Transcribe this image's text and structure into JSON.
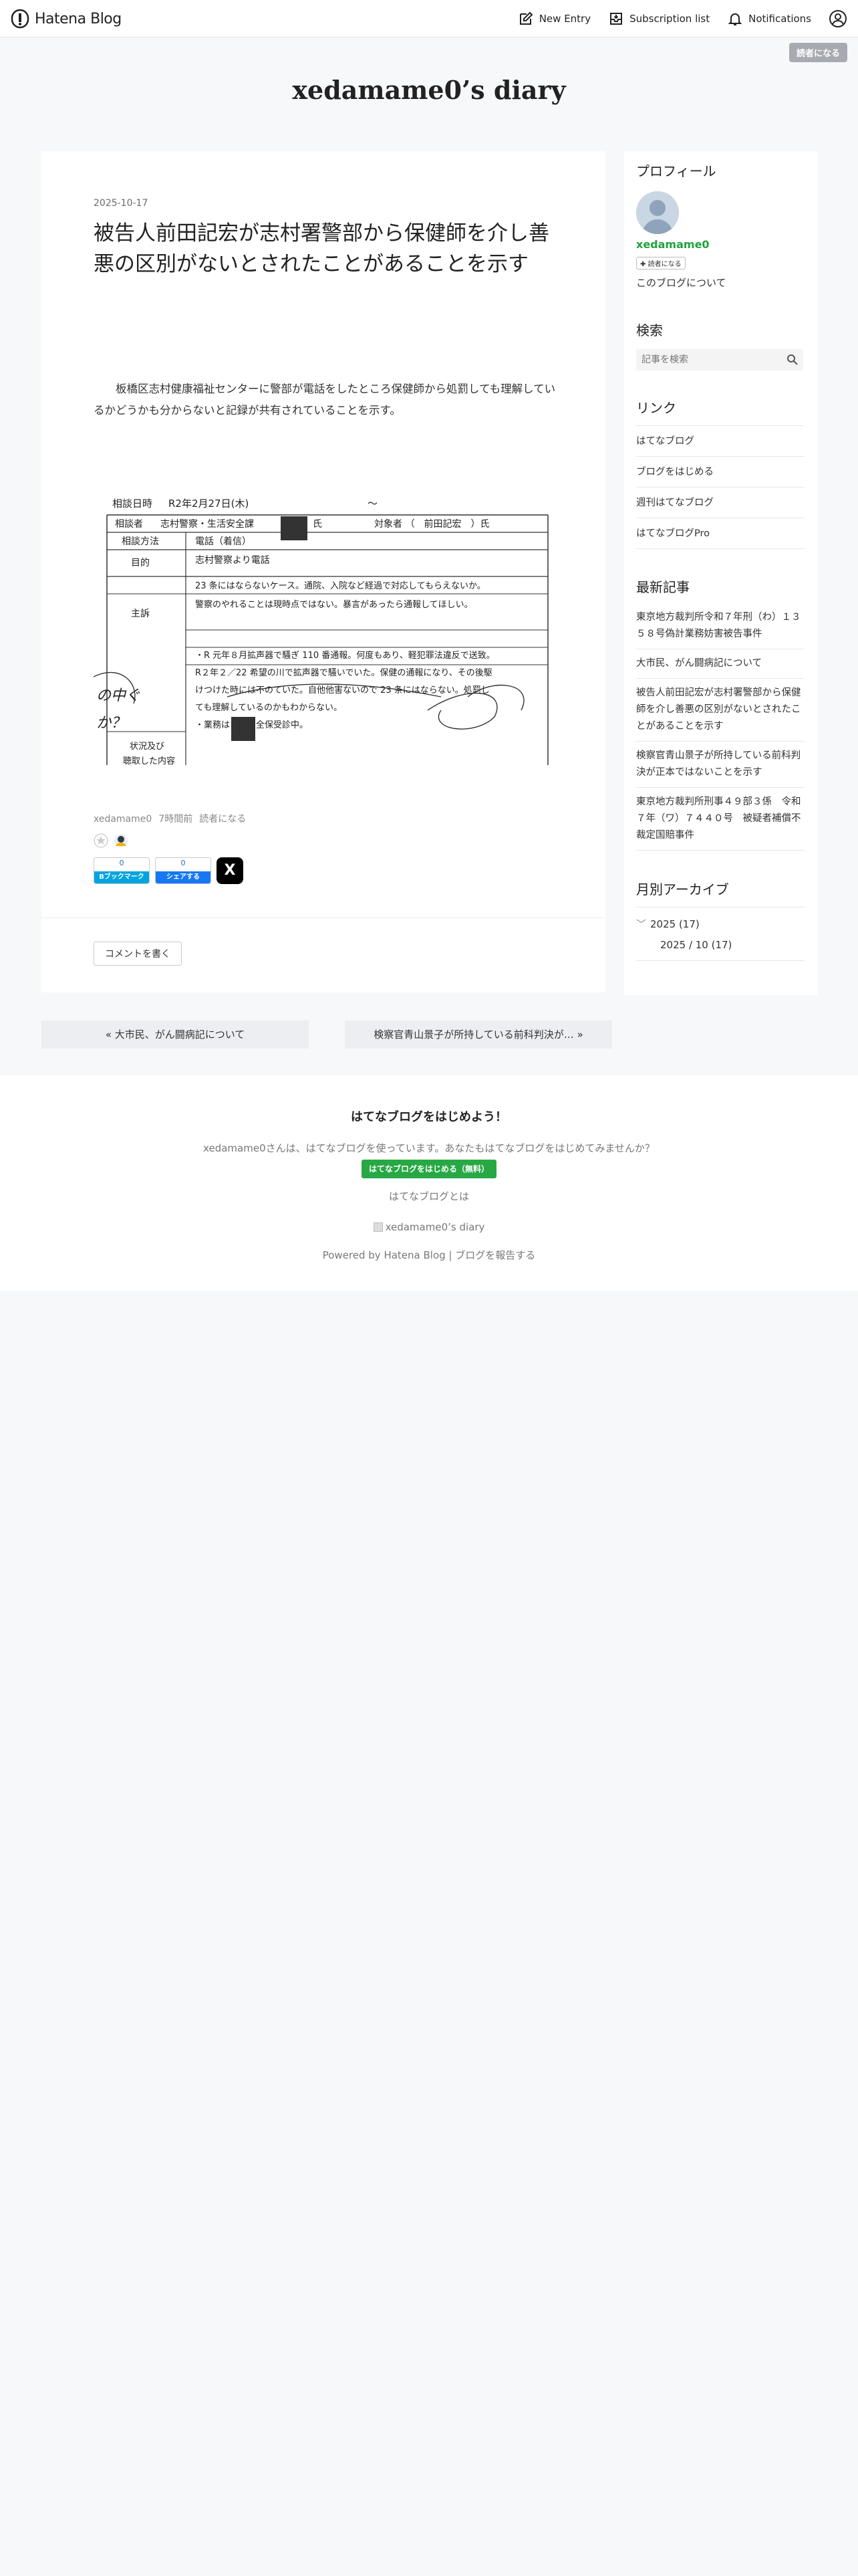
{
  "header": {
    "brand": "Hatena Blog",
    "nav": [
      {
        "label": "New Entry",
        "icon": "edit-icon"
      },
      {
        "label": "Subscription list",
        "icon": "inbox-icon"
      },
      {
        "label": "Notifications",
        "icon": "bell-icon"
      }
    ],
    "reader_badge": "読者になる"
  },
  "blog": {
    "title": "xedamame0’s diary"
  },
  "entry": {
    "date": "2025-10-17",
    "title": "被告人前田記宏が志村署警部から保健師を介し善悪の区別がないとされたことがあることを示す",
    "body": "板橋区志村健康福祉センターに警部が電話をしたところ保健師から処罰しても理解しているかどうかも分からないと記録が共有されていることを示す。",
    "document": {
      "line1_a": "相談日時",
      "line1_b": "R2年2月27日(木)",
      "line1_c": "～",
      "row2_a": "相談者",
      "row2_b": "志村警察・生活安全課",
      "row2_c": "氏",
      "row2_d": "対象者 （　前田記宏　）氏",
      "row3_a": "相談方法",
      "row3_b": "電話（着信）",
      "row4_a": "目的",
      "row4_b": "志村警察より電話",
      "row5_a": "主訴",
      "row5_line1": "23 条にはならないケース。通院、入院など経過で対応してもらえないか。",
      "row5_line2": "警察のやれることは現時点ではない。暴言があったら通報してほしい。",
      "row6_line1": "・R 元年８月拡声器で騒ぎ 110 番通報。何度もあり、軽犯罪法違反で送致。",
      "row6_line2": "R２年２／22 希望の川で拡声器で騒いでいた。保健の通報になり、その後駆",
      "row6_line3": "けつけた時には不のていた。自他他害ないので 23 条にはならない。処罰し",
      "row6_line4": "ても理解しているのかもわからない。",
      "row6_line5": "・業務は　　　全保受診中。",
      "row7_a": "状況及び",
      "row7_b": "聴取した内容",
      "hand_a": "の中ぐ",
      "hand_b": "か？"
    },
    "author": "xedamame0",
    "posted": "7時間前",
    "reader": "読者になる",
    "share": {
      "hatena_count": "0",
      "hatena_label": "Bブックマーク",
      "fb_count": "0",
      "fb_label": "シェアする",
      "x_label": "X"
    },
    "comment": "コメントを書く"
  },
  "sidebar": {
    "profile_heading": "プロフィール",
    "profile_name": "xedamame0",
    "profile_reader": "読者になる",
    "profile_about": "このブログについて",
    "search_heading": "検索",
    "search_placeholder": "記事を検索",
    "links_heading": "リンク",
    "links": [
      "はてなブログ",
      "ブログをはじめる",
      "週刊はてなブログ",
      "はてなブログPro"
    ],
    "recent_heading": "最新記事",
    "recent": [
      "東京地方裁判所令和７年刑（わ）１３５８号偽計業務妨害被告事件",
      "大市民、がん闘病記について",
      "被告人前田記宏が志村署警部から保健師を介し善悪の区別がないとされたことがあることを示す",
      "検察官青山景子が所持している前科判決が正本ではないことを示す",
      "東京地方裁判所刑事４９部３係　令和７年（ワ）７４４０号　被疑者補償不裁定国賠事件"
    ],
    "archive_heading": "月別アーカイブ",
    "archive_year": "2025 (17)",
    "archive_month": "2025 / 10 (17)"
  },
  "pager": {
    "prev": "« 大市民、がん闘病記について",
    "next": "検察官青山景子が所持している前科判決が… »"
  },
  "footer": {
    "promo_heading": "はてなブログをはじめよう！",
    "promo_text": "xedamame0さんは、はてなブログを使っています。あなたもはてなブログをはじめてみませんか？",
    "promo_button": "はてなブログをはじめる（無料）",
    "promo_link": "はてなブログとは",
    "blog_title": "xedamame0’s diary",
    "powered": "Powered by Hatena Blog",
    "report": "ブログを報告する"
  },
  "colors": {
    "accent_green": "#1fa33c",
    "hatena_blue": "#00a4de",
    "fb_blue": "#1877f2",
    "reader_badge": "#a7aab0"
  }
}
